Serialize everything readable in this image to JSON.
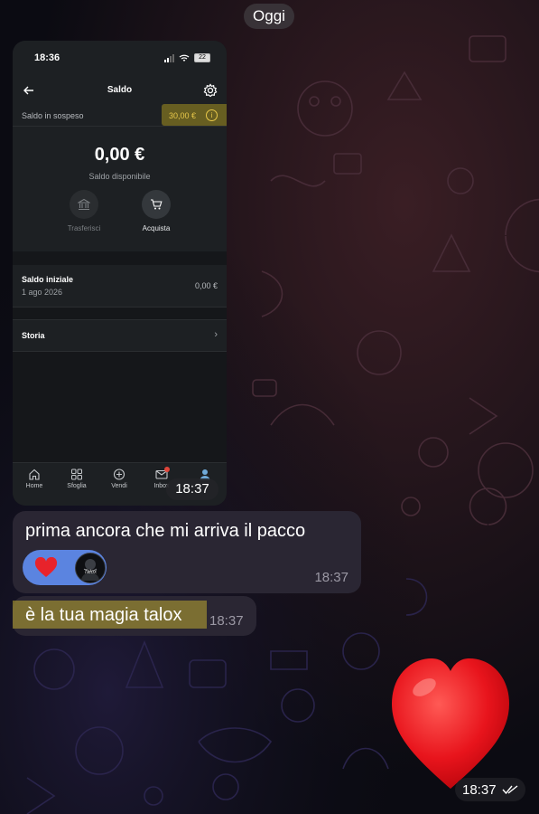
{
  "chat": {
    "date_label": "Oggi"
  },
  "screenshot": {
    "status_time": "18:36",
    "battery": "22",
    "title": "Saldo",
    "pending_label": "Saldo in sospeso",
    "pending_value": "30,00 €",
    "balance_amount": "0,00 €",
    "balance_label": "Saldo disponibile",
    "actions": [
      {
        "label": "Trasferisci",
        "icon": "bank-icon",
        "enabled": false
      },
      {
        "label": "Acquista",
        "icon": "cart-icon",
        "enabled": true
      }
    ],
    "start_balance": {
      "title": "Saldo iniziale",
      "date": "1 ago 2026",
      "value": "0,00 €"
    },
    "history_label": "Storia",
    "tabs": [
      {
        "label": "Home",
        "icon": "home-icon"
      },
      {
        "label": "Sfoglia",
        "icon": "grid-icon"
      },
      {
        "label": "Vendi",
        "icon": "plus-circle-icon"
      },
      {
        "label": "Inbox",
        "icon": "mail-icon"
      },
      {
        "label": "",
        "icon": "profile-icon"
      }
    ],
    "message_time": "18:37"
  },
  "messages": [
    {
      "text": "prima ancora che mi arriva il pacco",
      "time": "18:37",
      "reaction": "❤️"
    },
    {
      "text": "è la tua magia talox",
      "time": "18:37"
    },
    {
      "emoji": "❤️",
      "time": "18:37",
      "status": "read"
    }
  ],
  "colors": {
    "bubble": "#2a2633",
    "highlight": "#c8b02a",
    "reaction_bg": "#5b84e0"
  }
}
